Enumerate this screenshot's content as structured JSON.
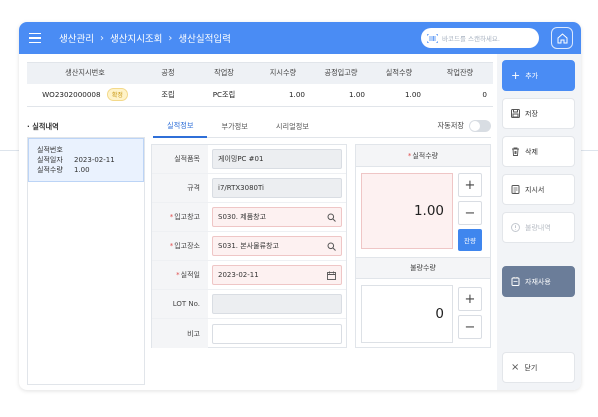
{
  "header": {
    "breadcrumb": [
      "생산관리",
      "생산지시조회",
      "생산실적입력"
    ],
    "scan_placeholder": "바코드를 스캔하세요."
  },
  "summary": {
    "headers": [
      "생산지시번호",
      "공정",
      "작업장",
      "지시수량",
      "공정입고량",
      "실적수량",
      "작업잔량"
    ],
    "row": {
      "order_no": "WO2302000008",
      "status_badge": "확정",
      "process": "조립",
      "workplace": "PC조립",
      "order_qty": "1.00",
      "process_in_qty": "1.00",
      "result_qty": "1.00",
      "remaining_qty": "0"
    }
  },
  "left": {
    "title": "· 실적내역",
    "record": {
      "no_label": "실적번호",
      "no_value": "",
      "date_label": "실적일자",
      "date_value": "2023-02-11",
      "qty_label": "실적수량",
      "qty_value": "1.00"
    }
  },
  "tabs": [
    "실적정보",
    "부가정보",
    "시리얼정보"
  ],
  "autosave_label": "자동저장",
  "form": {
    "fields": [
      {
        "label": "실적품목",
        "value": "게이밍PC #01",
        "required": false
      },
      {
        "label": "규격",
        "value": "i7/RTX3080Ti",
        "required": false
      },
      {
        "label": "입고창고",
        "value": "S030. 제품창고",
        "required": true
      },
      {
        "label": "입고장소",
        "value": "S031. 본사물류창고",
        "required": true
      },
      {
        "label": "실적일",
        "value": "2023-02-11",
        "required": true
      },
      {
        "label": "LOT No.",
        "value": "",
        "required": false
      },
      {
        "label": "비고",
        "value": "",
        "required": false
      }
    ]
  },
  "quantity": {
    "result_label": "실적수량",
    "result_value": "1.00",
    "remain_button": "잔량",
    "defect_label": "불량수량",
    "defect_value": "0"
  },
  "actions": [
    {
      "label": "추가",
      "icon": "plus-icon"
    },
    {
      "label": "저장",
      "icon": "save-icon"
    },
    {
      "label": "삭제",
      "icon": "trash-icon"
    },
    {
      "label": "지시서",
      "icon": "document-icon"
    },
    {
      "label": "불량내역",
      "icon": "warning-icon"
    },
    {
      "label": "자재사용",
      "icon": "clipboard-icon"
    },
    {
      "label": "닫기",
      "icon": "close-icon"
    }
  ],
  "colors": {
    "primary": "#4a8cf4",
    "dark_button": "#6b7d99",
    "required": "#e04c4c",
    "badge_text": "#c79612"
  }
}
